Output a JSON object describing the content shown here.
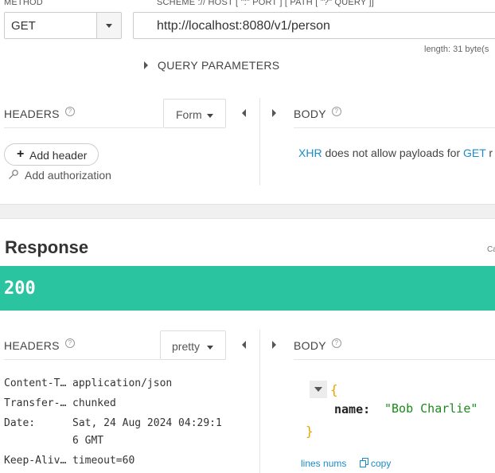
{
  "request": {
    "method_label": "METHOD",
    "method_value": "GET",
    "url_hint": "SCHEME :// HOST [ \":\" PORT ] [ PATH [ \"?\" QUERY ]]",
    "url_value": "http://localhost:8080/v1/person",
    "length_text": "length: 31 byte(s",
    "query_params_label": "QUERY PARAMETERS",
    "headers_label": "HEADERS",
    "headers_mode": "Form",
    "body_label": "BODY",
    "add_header_label": "Add header",
    "add_auth_label": "Add authorization",
    "body_msg_xhr": "XHR",
    "body_msg_mid": " does not allow payloads for ",
    "body_msg_get": "GET",
    "body_msg_tail": " r"
  },
  "response": {
    "title": "Response",
    "corner_text": "Ca",
    "status_code": "200",
    "status_color": "#2bc4a0",
    "headers_label": "HEADERS",
    "headers_mode": "pretty",
    "body_label": "BODY",
    "headers": [
      {
        "name": "Content-T…",
        "value": "application/json"
      },
      {
        "name": "Transfer-…",
        "value": "chunked"
      },
      {
        "name": "Date:",
        "value": "Sat, 24 Aug 2024 04:29:1",
        "value2": "6 GMT"
      },
      {
        "name": "Keep-Aliv…",
        "value": "timeout=60"
      }
    ],
    "body": {
      "open_brace": "{",
      "key": "name:",
      "value": "\"Bob Charlie\"",
      "close_brace": "}"
    },
    "lines_nums_label": "lines nums",
    "copy_label": "copy"
  }
}
